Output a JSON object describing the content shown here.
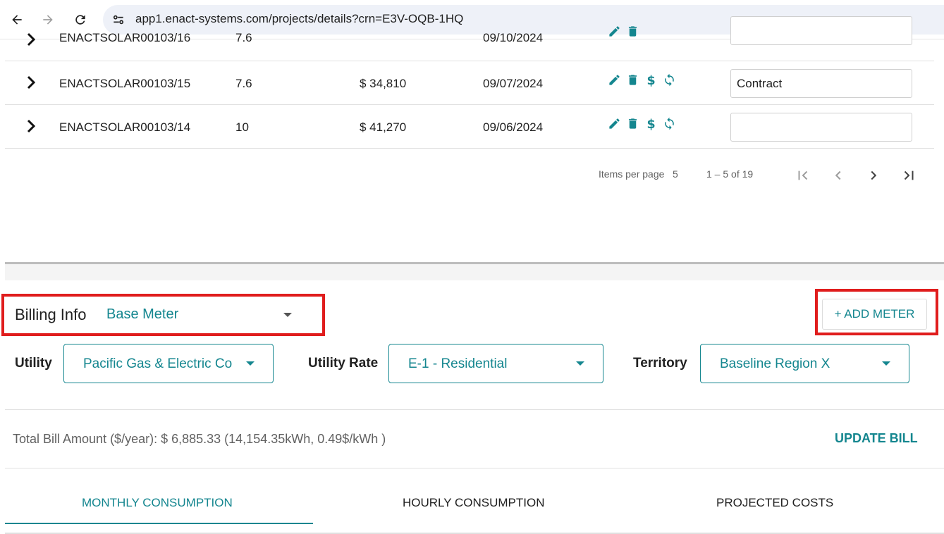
{
  "browser": {
    "url": "app1.enact-systems.com/projects/details?crn=E3V-OQB-1HQ"
  },
  "table": {
    "rows": [
      {
        "id": "ENACTSOLAR00103/16",
        "size": "7.6",
        "price": "",
        "date": "09/10/2024",
        "status": ""
      },
      {
        "id": "ENACTSOLAR00103/15",
        "size": "7.6",
        "price": "$ 34,810",
        "date": "09/07/2024",
        "status": "Contract"
      },
      {
        "id": "ENACTSOLAR00103/14",
        "size": "10",
        "price": "$ 41,270",
        "date": "09/06/2024",
        "status": ""
      }
    ]
  },
  "paginator": {
    "items_per_page_label": "Items per page",
    "items_per_page_value": "5",
    "range_label": "1 – 5 of 19"
  },
  "billing": {
    "title": "Billing Info",
    "meter": "Base Meter",
    "add_meter_label": "+ ADD METER",
    "utility_label": "Utility",
    "utility_value": "Pacific Gas & Electric Co",
    "rate_label": "Utility Rate",
    "rate_value": "E-1 - Residential",
    "territory_label": "Territory",
    "territory_value": "Baseline Region X",
    "total_text": "Total Bill Amount ($/year): $ 6,885.33 (14,154.35kWh, 0.49$/kWh )",
    "update_bill_label": "UPDATE BILL"
  },
  "tabs": [
    {
      "label": "MONTHLY CONSUMPTION",
      "active": true
    },
    {
      "label": "HOURLY CONSUMPTION",
      "active": false
    },
    {
      "label": "PROJECTED COSTS",
      "active": false
    }
  ],
  "colors": {
    "accent": "#14868f",
    "highlight": "#e01d1d"
  }
}
